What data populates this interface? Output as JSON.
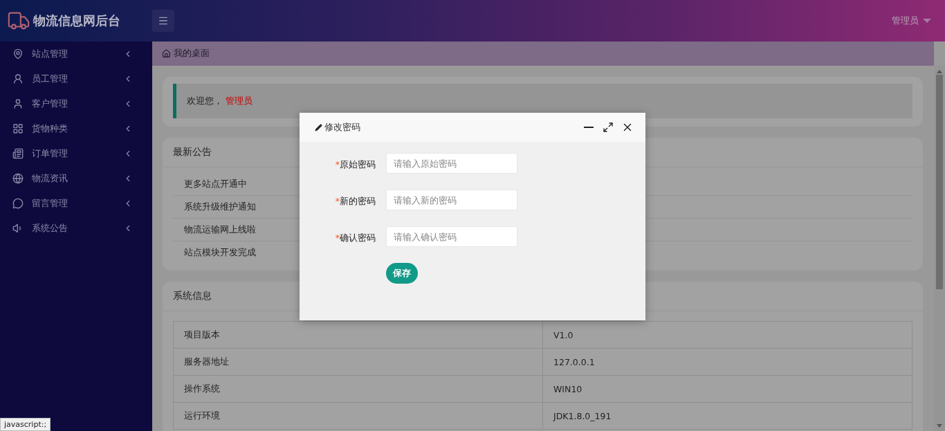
{
  "header": {
    "title": "物流信息网后台",
    "user": "管理员"
  },
  "sidebar": {
    "items": [
      {
        "label": "站点管理"
      },
      {
        "label": "员工管理"
      },
      {
        "label": "客户管理"
      },
      {
        "label": "货物种类"
      },
      {
        "label": "订单管理"
      },
      {
        "label": "物流资讯"
      },
      {
        "label": "留言管理"
      },
      {
        "label": "系统公告"
      }
    ]
  },
  "breadcrumb": "我的桌面",
  "welcome": {
    "text": "欢迎您，",
    "name": "管理员"
  },
  "announcements": {
    "title": "最新公告",
    "items": [
      "更多站点开通中",
      "系统升级维护通知",
      "物流运输网上线啦",
      "站点模块开发完成"
    ]
  },
  "system_info": {
    "title": "系统信息",
    "rows": [
      {
        "label": "项目版本",
        "value": "V1.0"
      },
      {
        "label": "服务器地址",
        "value": "127.0.0.1"
      },
      {
        "label": "操作系统",
        "value": "WIN10"
      },
      {
        "label": "运行环境",
        "value": "JDK1.8.0_191"
      }
    ]
  },
  "dialog": {
    "title": "修改密码",
    "fields": [
      {
        "mark": "*",
        "label": "原始密码",
        "placeholder": "请输入原始密码"
      },
      {
        "mark": "*",
        "label": "新的密码",
        "placeholder": "请输入新的密码"
      },
      {
        "mark": "*",
        "label": "确认密码",
        "placeholder": "请输入确认密码"
      }
    ],
    "button": "保存"
  },
  "status_bar": "javascript:;"
}
